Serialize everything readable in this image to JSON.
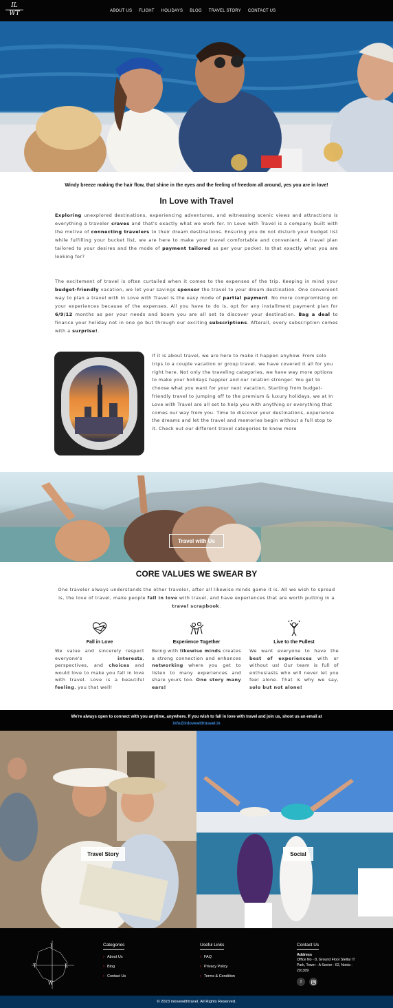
{
  "nav": {
    "logo_line1": "IL",
    "logo_line2": "WT",
    "items": [
      "ABOUT US",
      "FLIGHT",
      "HOLIDAYS",
      "BLOG",
      "TRAVEL STORY",
      "CONTACT US"
    ]
  },
  "intro": {
    "tagline": "Windy breeze making the hair flow, that shine in the eyes and the feeling of freedom all around, yes you are in love!",
    "title": "In Love with Travel",
    "p1": [
      {
        "b": "Exploring"
      },
      {
        "t": " unexplored destinations, experiencing adventures, and witnessing scenic views and attractions is everything a traveler "
      },
      {
        "b": "craves"
      },
      {
        "t": " and that's exactly what we work for. In Love with Travel is a company built with the motive of "
      },
      {
        "b": "connecting travelers"
      },
      {
        "t": " to their dream destinations. Ensuring you do not disturb your budget list while fulfilling your bucket list, we are here to make your travel comfortable and convenient. A travel plan tailored to your desires and the mode of "
      },
      {
        "b": "payment tailored"
      },
      {
        "t": " as per your pocket. Is that exactly what you are looking for?"
      }
    ],
    "p2": [
      {
        "t": "The excitement of travel is often curtailed when it comes to the expenses of the trip. Keeping in mind your "
      },
      {
        "b": "budget-friendly"
      },
      {
        "t": " vacation, we let your savings "
      },
      {
        "b": "sponsor"
      },
      {
        "t": " the travel to your dream destination. One convenient way to plan a travel with In Love with Travel is the easy mode of "
      },
      {
        "b": "partial payment"
      },
      {
        "t": ". No more compromising on your experiences because of the expenses. All you have to do is, opt for any installment payment plan for "
      },
      {
        "b": "6/9/12"
      },
      {
        "t": " months as per your needs and boom you are all set to discover your destination. "
      },
      {
        "b": "Bag a deal"
      },
      {
        "t": " to finance your holiday not in one go but through our exciting "
      },
      {
        "b": "subscriptions"
      },
      {
        "t": ". Afterall, every subscription comes with a "
      },
      {
        "b": "surprise!"
      },
      {
        "t": "."
      }
    ],
    "p3": "If it is about travel, we are here to make it happen anyhow. From solo trips to a couple vacation or group travel, we have covered it all for you right here. Not only the traveling categories, we have way more options to make your holidays happier and our relation stronger. You get to choose what you want for your next vacation. Starting from budget-friendly travel to jumping off to the premium & luxury holidays, we at In Love with Travel are all set to help you with anything or everything that comes our way from you. Time to discover your destinations, experience the dreams and let the travel and memories begin without a full stop to it. Check out our different travel categories to know more"
  },
  "band": {
    "button": "Travel with Us"
  },
  "core": {
    "title": "CORE VALUES WE SWEAR BY",
    "intro": [
      {
        "t": "One traveler always understands the other traveler, after all likewise minds game it is. All we wish to spread is, the love of travel, make people "
      },
      {
        "b": "fall in love"
      },
      {
        "t": " with travel, and have experiences that are worth putting in a "
      },
      {
        "b": "travel scrapbook"
      },
      {
        "t": "."
      }
    ],
    "values": [
      {
        "title": "Fall in Love",
        "icon": "heart-plane-icon",
        "desc": [
          {
            "t": "We value and sincerely respect everyone's "
          },
          {
            "b": "interests"
          },
          {
            "t": ", perspectives, and "
          },
          {
            "b": "choices"
          },
          {
            "t": " and would love to make you fall in love with travel. Love is a beautiful "
          },
          {
            "b": "feeling"
          },
          {
            "t": ", you that well!"
          }
        ]
      },
      {
        "title": "Experience Together",
        "icon": "people-together-icon",
        "desc": [
          {
            "t": "Being with "
          },
          {
            "b": "likewise minds"
          },
          {
            "t": " creates a strong connection and enhances "
          },
          {
            "b": "networking"
          },
          {
            "t": " where you get to listen to many experiences and share yours too. "
          },
          {
            "b": "One story many ears!"
          }
        ]
      },
      {
        "title": "Live to the Fullest",
        "icon": "joyful-person-icon",
        "desc": [
          {
            "t": "We want everyone to have the "
          },
          {
            "b": "best of experiences"
          },
          {
            "t": " with or without us! Our team is full of enthusiasts who will never let you feel alone. That is why we say, "
          },
          {
            "b": "solo but not alone!"
          }
        ]
      }
    ]
  },
  "cta": {
    "text": "We're always open to connect with you anytime, anywhere. If you wish to fall in love with travel and join us, shoot us an email at",
    "email": "info@inlovewithtravel.in",
    "link_color": "#3f8de0"
  },
  "gallery": {
    "left_button": "Travel Story",
    "right_button": "Social"
  },
  "footer": {
    "categories_title": "Categories",
    "categories": [
      "About Us",
      "Blog",
      "Contact Us"
    ],
    "links_title": "Useful Links",
    "links": [
      "FAQ",
      "Privacy Policy",
      "Terms & Condition"
    ],
    "contact_title": "Contact Us",
    "address_label": "Address",
    "address": "Office No - 8, Ground Floor Stellar IT Park, Tower - A Sector - 62, Noida - 201309",
    "social_icons": [
      "facebook-icon",
      "instagram-icon"
    ],
    "map_letters": [
      "I",
      "L",
      "W",
      "T"
    ],
    "accent": "#e33333"
  },
  "copyright": "© 2023 inlovewithtravel. All Rights Reserved.",
  "colors": {
    "nav_bg": "#050505",
    "copyright_bg": "#06325a"
  }
}
